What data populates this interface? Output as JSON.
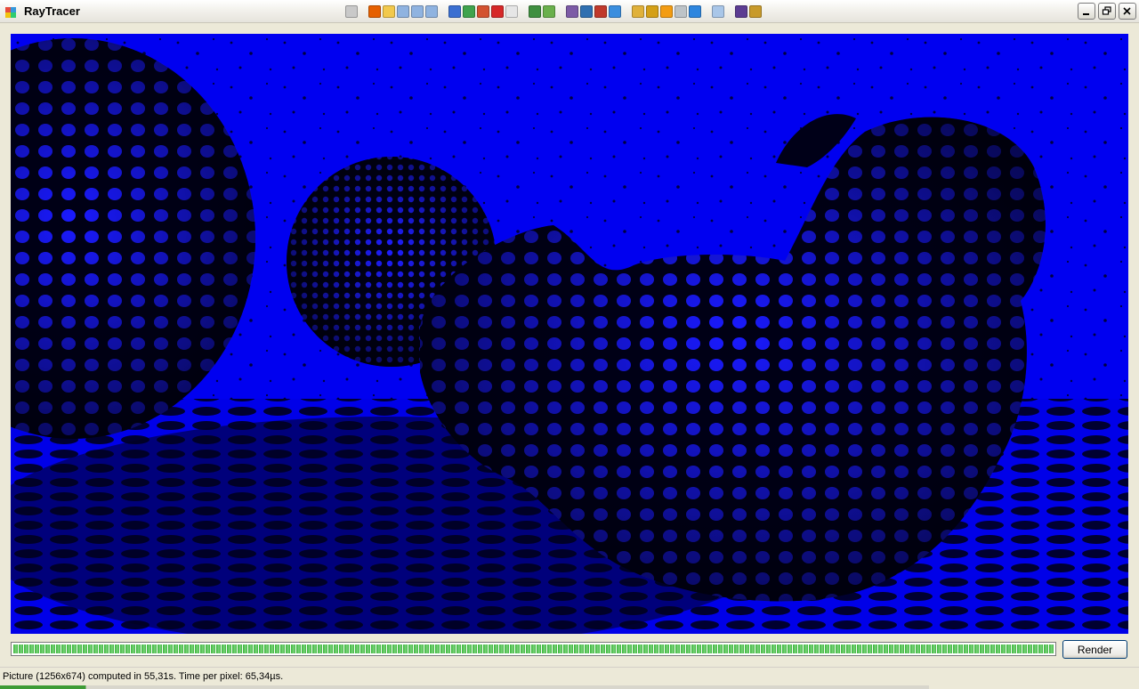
{
  "window": {
    "title": "RayTracer",
    "icon": "window-app-icon"
  },
  "quicklaunch_icons": [
    {
      "name": "trophy-icon",
      "color": "#c9c9c9"
    },
    {
      "name": "firefox-icon",
      "color": "#e66000"
    },
    {
      "name": "messenger-icon",
      "color": "#f2c94c"
    },
    {
      "name": "folder-icon",
      "color": "#8fb3e0"
    },
    {
      "name": "folder-icon-2",
      "color": "#8fb3e0"
    },
    {
      "name": "folder-icon-3",
      "color": "#8fb3e0"
    },
    {
      "name": "word-icon",
      "color": "#3b6fd1"
    },
    {
      "name": "excel-icon",
      "color": "#3fa34d"
    },
    {
      "name": "powerpoint-icon",
      "color": "#d35230"
    },
    {
      "name": "pdf-icon",
      "color": "#d62828"
    },
    {
      "name": "document-icon",
      "color": "#e6e6e6"
    },
    {
      "name": "paint-icon",
      "color": "#3f8f3f"
    },
    {
      "name": "pen-icon",
      "color": "#6ab04c"
    },
    {
      "name": "media-icon",
      "color": "#7d5ba6"
    },
    {
      "name": "globe-icon",
      "color": "#2f6fb0"
    },
    {
      "name": "tools-icon",
      "color": "#c0392b"
    },
    {
      "name": "ie-icon",
      "color": "#3b8ede"
    },
    {
      "name": "pencil-icon",
      "color": "#e0b13a"
    },
    {
      "name": "ruler-icon",
      "color": "#d4a017"
    },
    {
      "name": "vlc-icon",
      "color": "#f39c12"
    },
    {
      "name": "disc-icon",
      "color": "#bdc3c7"
    },
    {
      "name": "player-icon",
      "color": "#2e86de"
    },
    {
      "name": "notepad-icon",
      "color": "#a9c6e8"
    },
    {
      "name": "vs-icon",
      "color": "#5c3c92"
    },
    {
      "name": "winamp-icon",
      "color": "#c89a2a"
    }
  ],
  "render": {
    "button_label": "Render",
    "progress": 1.0
  },
  "status": {
    "text": "Picture (1256x674) computed in 55,31s. Time per pixel: 65,34µs."
  },
  "colors": {
    "scene_blue": "#0000f0",
    "progress_green": "#38b538"
  }
}
